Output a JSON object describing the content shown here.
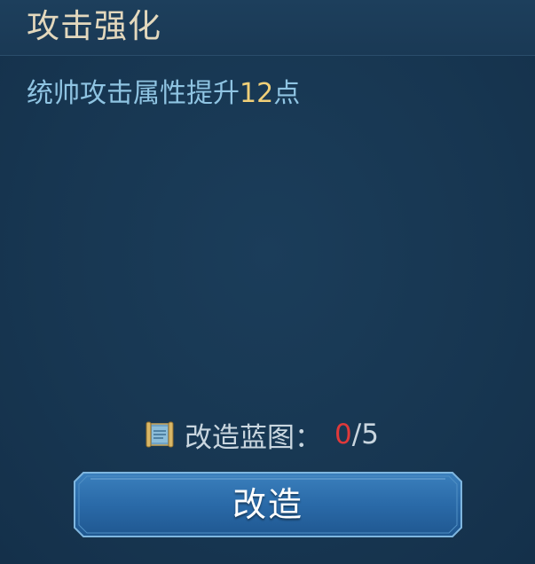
{
  "panel": {
    "title": "攻击强化",
    "description": {
      "prefix": "统帅攻击属性提升",
      "value": "12",
      "suffix": "点"
    },
    "blueprint": {
      "icon": "blueprint-scroll-icon",
      "label": "改造蓝图：",
      "current": "0",
      "separator": "/",
      "total": "5"
    },
    "button": {
      "label": "改造"
    }
  },
  "colors": {
    "background": "#173651",
    "title": "#e3d8bd",
    "description": "#8fc4e2",
    "highlight_value": "#f0cf78",
    "insufficient_count": "#e0393a",
    "button": "#2a6aa8"
  }
}
